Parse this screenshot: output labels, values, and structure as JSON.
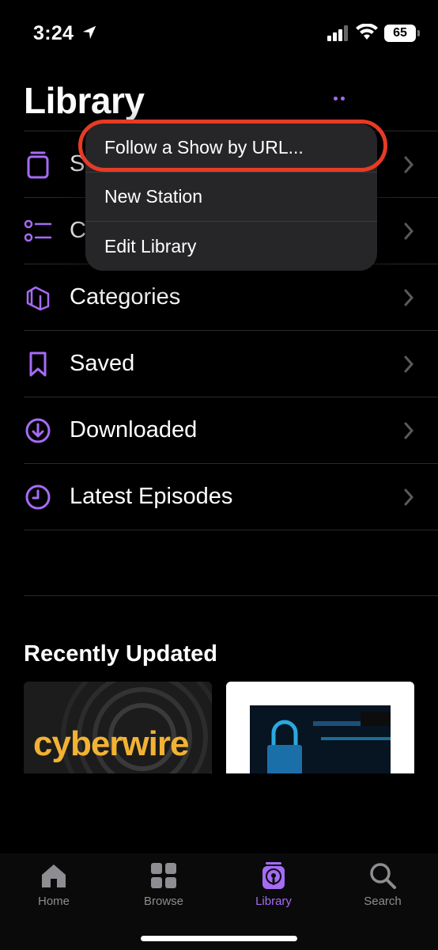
{
  "status": {
    "time": "3:24",
    "battery": "65"
  },
  "header": {
    "title": "Library"
  },
  "list": {
    "items": [
      {
        "label": "Shows",
        "visible_label": "S",
        "icon": "stack-icon"
      },
      {
        "label": "Channels",
        "visible_label": "C",
        "icon": "list-icon"
      },
      {
        "label": "Categories",
        "icon": "category-icon"
      },
      {
        "label": "Saved",
        "icon": "bookmark-icon"
      },
      {
        "label": "Downloaded",
        "icon": "download-icon"
      },
      {
        "label": "Latest Episodes",
        "icon": "clock-icon"
      }
    ]
  },
  "menu": {
    "items": [
      {
        "label": "Follow a Show by URL..."
      },
      {
        "label": "New Station"
      },
      {
        "label": "Edit Library"
      }
    ]
  },
  "recent": {
    "title": "Recently Updated",
    "cards": [
      {
        "label": "cyberwire"
      },
      {
        "label": ""
      }
    ]
  },
  "tabs": [
    {
      "label": "Home",
      "icon": "home-icon"
    },
    {
      "label": "Browse",
      "icon": "grid-icon"
    },
    {
      "label": "Library",
      "icon": "podcast-library-icon",
      "active": true
    },
    {
      "label": "Search",
      "icon": "search-icon"
    }
  ],
  "colors": {
    "accent": "#a66bf5",
    "highlight": "#e63b26",
    "menu_bg": "#262628"
  }
}
